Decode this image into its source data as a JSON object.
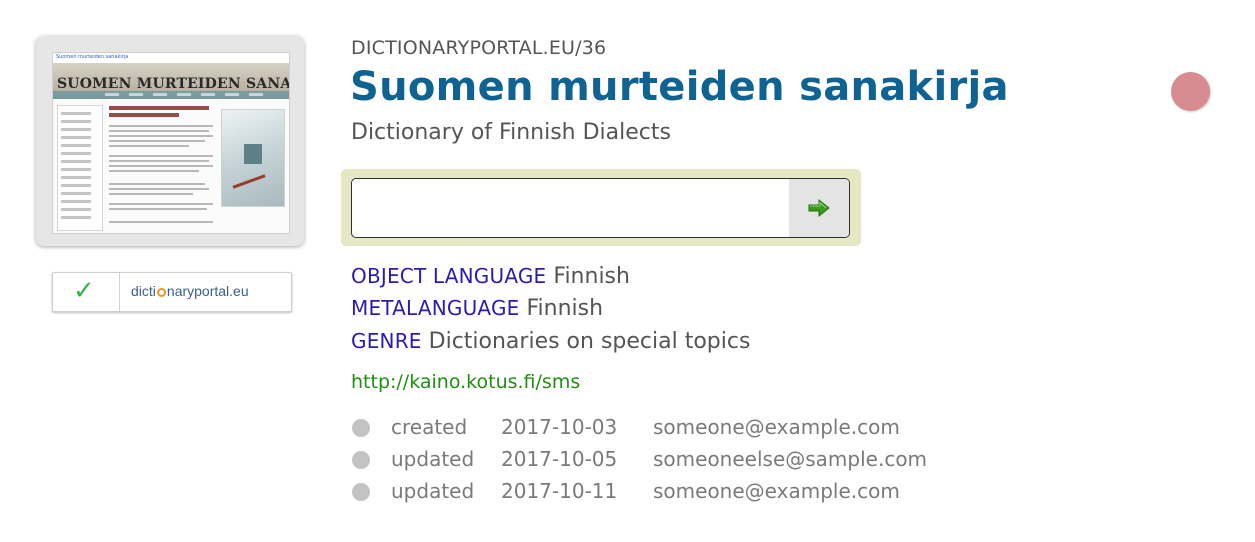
{
  "header": {
    "kicker": "DICTIONARYPORTAL.EU/36",
    "title": "Suomen murteiden sanakirja",
    "subtitle": "Dictionary of Finnish Dialects"
  },
  "status": {
    "dot_color": "#d88c91"
  },
  "thumbnail": {
    "top_link": "Suomen murteiden sanakirja",
    "banner_title": "SUOMEN MURTEIDEN SANAKIRJA"
  },
  "badge": {
    "icon": "checkmark-icon",
    "text_before": "dicti",
    "text_after": "naryportal.eu"
  },
  "search": {
    "value": "",
    "placeholder": "",
    "button_icon": "arrow-right-icon"
  },
  "meta": [
    {
      "key": "OBJECT LANGUAGE",
      "value": "Finnish"
    },
    {
      "key": "METALANGUAGE",
      "value": "Finnish"
    },
    {
      "key": "GENRE",
      "value": "Dictionaries on special topics"
    }
  ],
  "url": "http://kaino.kotus.fi/sms",
  "log": [
    {
      "action": "created",
      "date": "2017-10-03",
      "user": "someone@example.com"
    },
    {
      "action": "updated",
      "date": "2017-10-05",
      "user": "someoneelse@sample.com"
    },
    {
      "action": "updated",
      "date": "2017-10-11",
      "user": "someone@example.com"
    }
  ],
  "colors": {
    "title": "#0f6392",
    "meta_key": "#2c1bb3",
    "url": "#1e9010",
    "search_frame": "#e6e8c4"
  }
}
